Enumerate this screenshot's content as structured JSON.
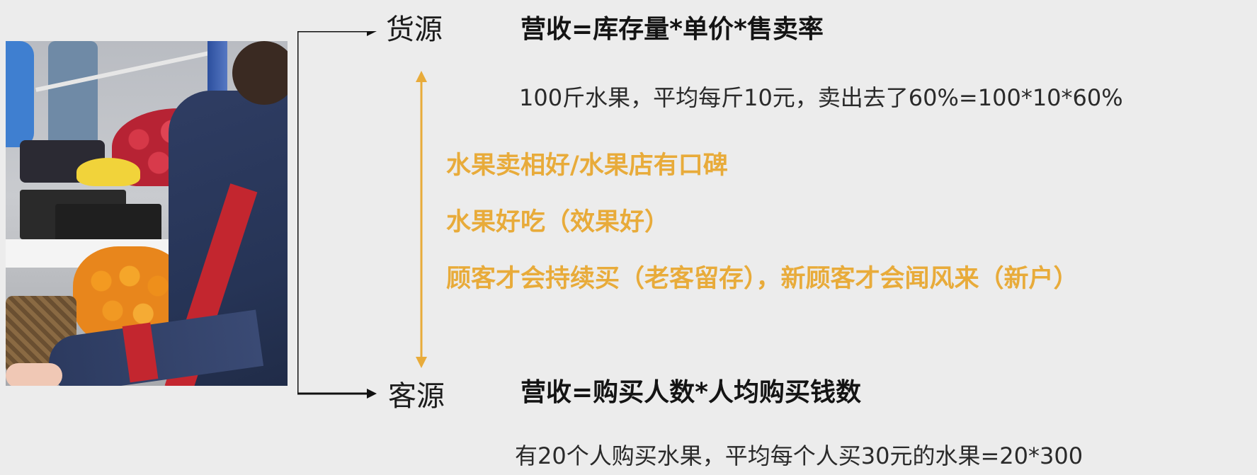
{
  "slide": {
    "source_label": "货源",
    "customer_label": "客源",
    "source_formula": "营收=库存量*单价*售卖率",
    "source_example": "100斤水果，平均每斤10元，卖出去了60%=100*10*60%",
    "reasons": [
      "水果卖相好/水果店有口碑",
      "水果好吃（效果好）",
      "顾客才会持续买（老客留存），新顾客才会闻风来（新户）"
    ],
    "customer_formula": "营收=购买人数*人均购买钱数",
    "customer_example": "有20个人购买水果，平均每个人买30元的水果=20*300"
  },
  "colors": {
    "background": "#ececec",
    "accent_orange": "#e8ab3a",
    "text_dark": "#141414"
  }
}
